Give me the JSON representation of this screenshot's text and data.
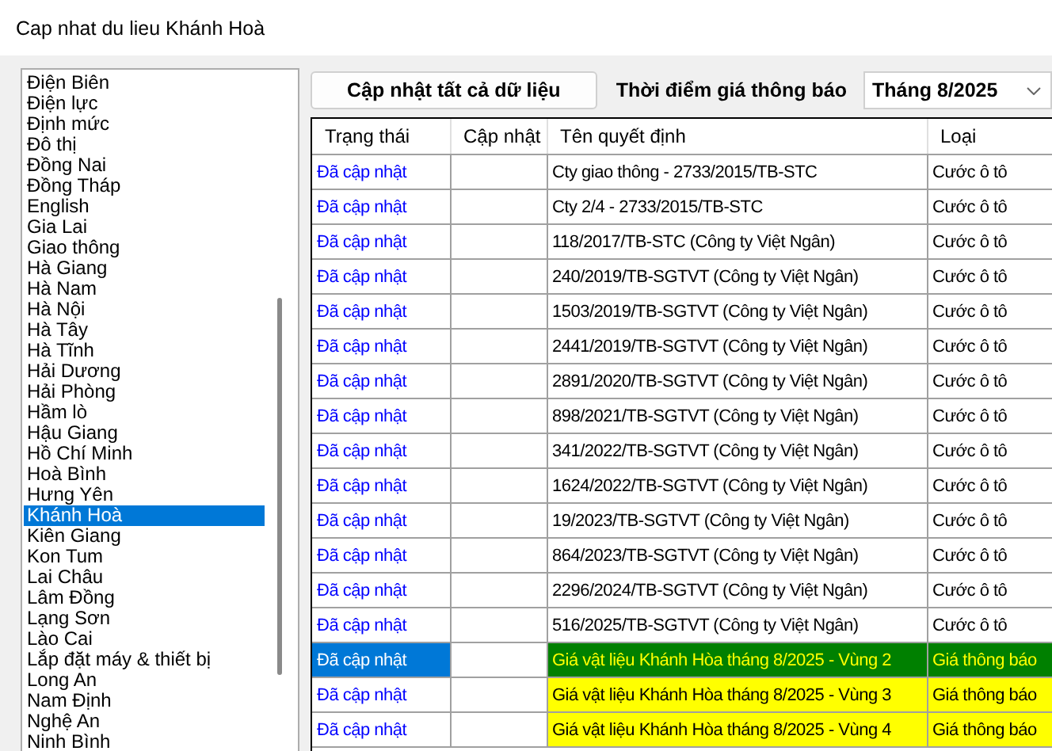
{
  "window": {
    "title": "Cap nhat du lieu Khánh Hoà"
  },
  "provinces": [
    {
      "label": "Điện Biên",
      "selected": false
    },
    {
      "label": "Điện lực",
      "selected": false
    },
    {
      "label": "Định mức",
      "selected": false
    },
    {
      "label": "Đô thị",
      "selected": false
    },
    {
      "label": "Đồng Nai",
      "selected": false
    },
    {
      "label": "Đồng Tháp",
      "selected": false
    },
    {
      "label": "English",
      "selected": false
    },
    {
      "label": "Gia Lai",
      "selected": false
    },
    {
      "label": "Giao thông",
      "selected": false
    },
    {
      "label": "Hà Giang",
      "selected": false
    },
    {
      "label": "Hà Nam",
      "selected": false
    },
    {
      "label": "Hà Nội",
      "selected": false
    },
    {
      "label": "Hà Tây",
      "selected": false
    },
    {
      "label": "Hà Tĩnh",
      "selected": false
    },
    {
      "label": "Hải Dương",
      "selected": false
    },
    {
      "label": "Hải Phòng",
      "selected": false
    },
    {
      "label": "Hầm lò",
      "selected": false
    },
    {
      "label": "Hậu Giang",
      "selected": false
    },
    {
      "label": "Hồ Chí Minh",
      "selected": false
    },
    {
      "label": "Hoà Bình",
      "selected": false
    },
    {
      "label": "Hưng Yên",
      "selected": false
    },
    {
      "label": "Khánh Hoà",
      "selected": true
    },
    {
      "label": "Kiên Giang",
      "selected": false
    },
    {
      "label": "Kon Tum",
      "selected": false
    },
    {
      "label": "Lai Châu",
      "selected": false
    },
    {
      "label": "Lâm Đồng",
      "selected": false
    },
    {
      "label": "Lạng Sơn",
      "selected": false
    },
    {
      "label": "Lào Cai",
      "selected": false
    },
    {
      "label": "Lắp đặt máy & thiết bị",
      "selected": false
    },
    {
      "label": "Long An",
      "selected": false
    },
    {
      "label": "Nam Định",
      "selected": false
    },
    {
      "label": "Nghệ An",
      "selected": false
    },
    {
      "label": "Ninh Bình",
      "selected": false
    }
  ],
  "update_all_button": "Cập nhật tất cả dữ liệu",
  "price_time": {
    "label": "Thời điểm giá thông báo",
    "value": "Tháng 8/2025"
  },
  "table": {
    "columns": [
      "Trạng thái",
      "Cập nhật",
      "Tên quyết định",
      "Loại"
    ],
    "rows": [
      {
        "status": "Đã cập nhật",
        "name": "Cty giao thông - 2733/2015/TB-STC",
        "type": "Cước ô tô",
        "highlighted": false,
        "selected": false
      },
      {
        "status": "Đã cập nhật",
        "name": "Cty 2/4 - 2733/2015/TB-STC",
        "type": "Cước ô tô",
        "highlighted": false,
        "selected": false
      },
      {
        "status": "Đã cập nhật",
        "name": "118/2017/TB-STC (Công ty Việt Ngân)",
        "type": "Cước ô tô",
        "highlighted": false,
        "selected": false
      },
      {
        "status": "Đã cập nhật",
        "name": "240/2019/TB-SGTVT (Công ty Việt Ngân)",
        "type": "Cước ô tô",
        "highlighted": false,
        "selected": false
      },
      {
        "status": "Đã cập nhật",
        "name": "1503/2019/TB-SGTVT (Công ty Việt Ngân)",
        "type": "Cước ô tô",
        "highlighted": false,
        "selected": false
      },
      {
        "status": "Đã cập nhật",
        "name": "2441/2019/TB-SGTVT (Công ty Việt Ngân)",
        "type": "Cước ô tô",
        "highlighted": false,
        "selected": false
      },
      {
        "status": "Đã cập nhật",
        "name": "2891/2020/TB-SGTVT (Công ty Việt Ngân)",
        "type": "Cước ô tô",
        "highlighted": false,
        "selected": false
      },
      {
        "status": "Đã cập nhật",
        "name": "898/2021/TB-SGTVT (Công ty Việt Ngân)",
        "type": "Cước ô tô",
        "highlighted": false,
        "selected": false
      },
      {
        "status": "Đã cập nhật",
        "name": "341/2022/TB-SGTVT (Công ty Việt Ngân)",
        "type": "Cước ô tô",
        "highlighted": false,
        "selected": false
      },
      {
        "status": "Đã cập nhật",
        "name": "1624/2022/TB-SGTVT (Công ty Việt Ngân)",
        "type": "Cước ô tô",
        "highlighted": false,
        "selected": false
      },
      {
        "status": "Đã cập nhật",
        "name": "19/2023/TB-SGTVT (Công ty Việt Ngân)",
        "type": "Cước ô tô",
        "highlighted": false,
        "selected": false
      },
      {
        "status": "Đã cập nhật",
        "name": "864/2023/TB-SGTVT (Công ty Việt Ngân)",
        "type": "Cước ô tô",
        "highlighted": false,
        "selected": false
      },
      {
        "status": "Đã cập nhật",
        "name": "2296/2024/TB-SGTVT (Công ty Việt Ngân)",
        "type": "Cước ô tô",
        "highlighted": false,
        "selected": false
      },
      {
        "status": "Đã cập nhật",
        "name": "516/2025/TB-SGTVT (Công ty Việt Ngân)",
        "type": "Cước ô tô",
        "highlighted": false,
        "selected": false
      },
      {
        "status": "Đã cập nhật",
        "name": "Giá vật liệu Khánh Hòa tháng 8/2025 - Vùng 2",
        "type": "Giá thông báo",
        "highlighted": true,
        "selected": true
      },
      {
        "status": "Đã cập nhật",
        "name": "Giá vật liệu Khánh Hòa tháng 8/2025 - Vùng 3",
        "type": "Giá thông báo",
        "highlighted": true,
        "selected": false
      },
      {
        "status": "Đã cập nhật",
        "name": "Giá vật liệu Khánh Hòa tháng 8/2025 - Vùng 4",
        "type": "Giá thông báo",
        "highlighted": true,
        "selected": false
      }
    ]
  }
}
